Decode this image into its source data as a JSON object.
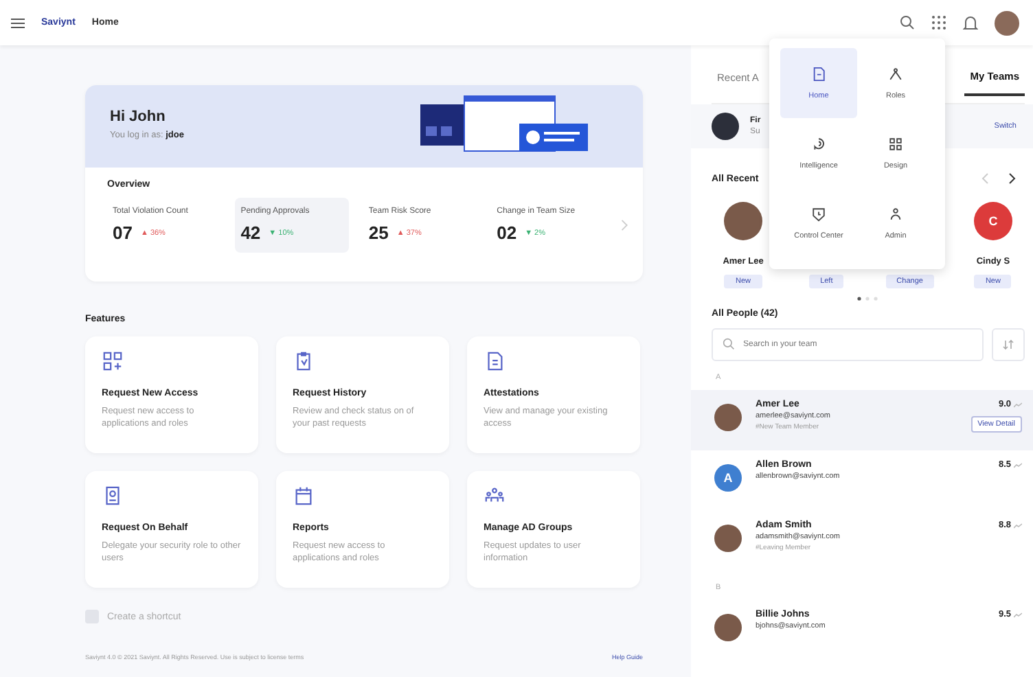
{
  "topbar": {
    "logo": "Saviynt",
    "page_title": "Home"
  },
  "hero": {
    "greeting": "Hi John",
    "login_note": "You log in as: **jdoe**"
  },
  "overview": {
    "title": "Overview",
    "stats": [
      {
        "label": "Total Violation Count",
        "value": "07",
        "change": "▲ 36%",
        "color": "#e05a5a",
        "selected": false
      },
      {
        "label": "Pending Approvals",
        "value": "42",
        "change": "▼ 10%",
        "color": "#3bb273",
        "selected": true
      },
      {
        "label": "Team Risk Score",
        "value": "25",
        "change": "▲ 37%",
        "color": "#e05a5a",
        "selected": false
      },
      {
        "label": "Change in Team Size",
        "value": "02",
        "change": "▼ 2%",
        "color": "#3bb273",
        "selected": false
      }
    ]
  },
  "features": {
    "title": "Features",
    "items": [
      {
        "kind": "nodes",
        "title": "Request New Access",
        "description": "Request new access to applications and roles"
      },
      {
        "kind": "clipboard",
        "title": "Request History",
        "description": "Review and check status on of your past requests"
      },
      {
        "kind": "document",
        "title": "Attestations",
        "description": "View and manage your existing access"
      },
      {
        "kind": "badge",
        "title": "Request On Behalf",
        "description": "Delegate your security role to other users"
      },
      {
        "kind": "calendar",
        "title": "Reports",
        "description": "Request new access to applications and roles"
      },
      {
        "kind": "group",
        "title": "Manage AD Groups",
        "description": "Request updates to user information"
      }
    ],
    "shortcut": "Create a shortcut"
  },
  "footer": {
    "legal": "Saviynt 4.0 © 2021 Saviynt. All Rights Reserved. Use is subject to license terms",
    "help": "Help Guide"
  },
  "panel": {
    "tabs": [
      {
        "label": "Recent A",
        "selected": false
      },
      {
        "label": "My Teams",
        "selected": true
      }
    ],
    "team": {
      "name": "Fir",
      "sub": "Su",
      "action": "Switch"
    },
    "recent_title": "All Recent",
    "recent": [
      {
        "name": "Amer Lee",
        "badge": "New",
        "kind": "photo"
      },
      {
        "badge": "Left",
        "kind": "hidden"
      },
      {
        "badge": "Change",
        "kind": "hidden"
      },
      {
        "name": "Cindy S",
        "badge": "New",
        "kind": "initial",
        "initial": "C",
        "color": "#dc3b3b"
      }
    ],
    "people_title": "All People (42)",
    "search": {
      "placeholder": "Search in your team"
    },
    "groups": [
      {
        "letter": "A",
        "people": [
          {
            "name": "Amer Lee",
            "email": "amerlee@saviynt.com",
            "tag": "#New Team Member",
            "score": "9.0",
            "kind": "photo",
            "selected": true,
            "action": "View Detail"
          },
          {
            "name": "Allen Brown",
            "email": "allenbrown@saviynt.com",
            "score": "8.5",
            "kind": "initial",
            "initial": "A",
            "color": "#3f7fd0",
            "selected": false
          },
          {
            "name": "Adam Smith",
            "email": "adamsmith@saviynt.com",
            "tag": "#Leaving Member",
            "score": "8.8",
            "kind": "photo",
            "selected": false
          }
        ]
      },
      {
        "letter": "B",
        "people": [
          {
            "name": "Billie Johns",
            "email": "bjohns@saviynt.com",
            "score": "9.5",
            "kind": "photo",
            "selected": false
          }
        ]
      }
    ]
  },
  "app_menu": [
    {
      "kind": "home",
      "label": "Home",
      "selected": true
    },
    {
      "kind": "roles",
      "label": "Roles",
      "selected": false
    },
    {
      "kind": "intelligence",
      "label": "Intelligence",
      "selected": false
    },
    {
      "kind": "design",
      "label": "Design",
      "selected": false
    },
    {
      "kind": "control",
      "label": "Control Center",
      "selected": false
    },
    {
      "kind": "admin",
      "label": "Admin",
      "selected": false
    }
  ]
}
